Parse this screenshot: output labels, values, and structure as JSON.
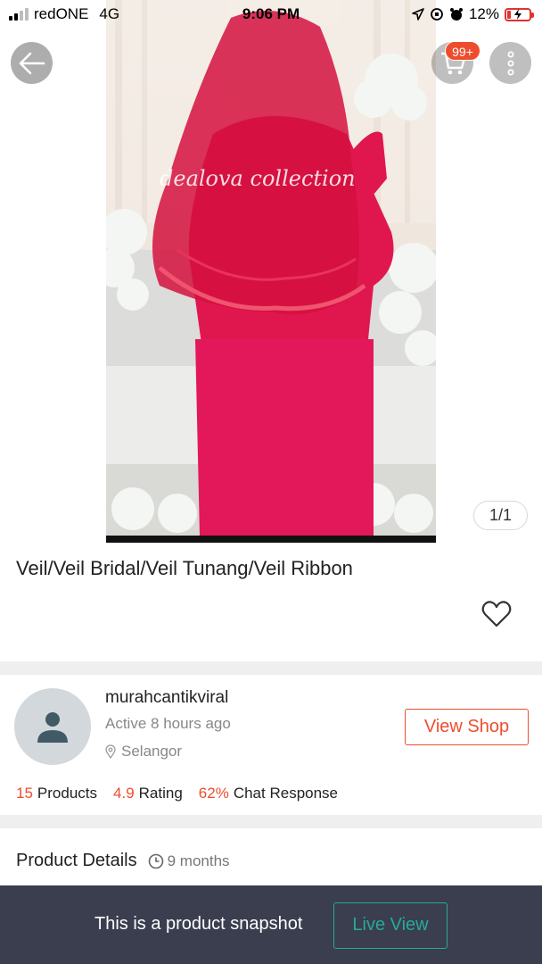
{
  "status_bar": {
    "carrier": "redONE",
    "network": "4G",
    "time": "9:06 PM",
    "battery": "12%"
  },
  "header": {
    "back_icon": "arrow-left-icon",
    "cart_icon": "shopping-cart-icon",
    "cart_badge": "99+",
    "more_icon": "more-vertical-icon"
  },
  "product": {
    "image_watermark": "dealova collection",
    "page_indicator": "1/1",
    "title": "Veil/Veil Bridal/Veil Tunang/Veil Ribbon",
    "like_icon": "heart-outline-icon"
  },
  "shop": {
    "name": "murahcantikviral",
    "active": "Active 8 hours ago",
    "location": "Selangor",
    "view_shop_label": "View Shop",
    "stats": [
      {
        "value": "15",
        "label": "Products"
      },
      {
        "value": "4.9",
        "label": "Rating"
      },
      {
        "value": "62%",
        "label": "Chat Response"
      }
    ]
  },
  "details": {
    "title": "Product Details",
    "age": "9 months"
  },
  "bottom_bar": {
    "snapshot_text": "This is a product snapshot",
    "live_view_label": "Live View"
  },
  "colors": {
    "accent": "#ee4d2d",
    "teal": "#26aa99",
    "bottom_bar": "#3a3e4f"
  }
}
